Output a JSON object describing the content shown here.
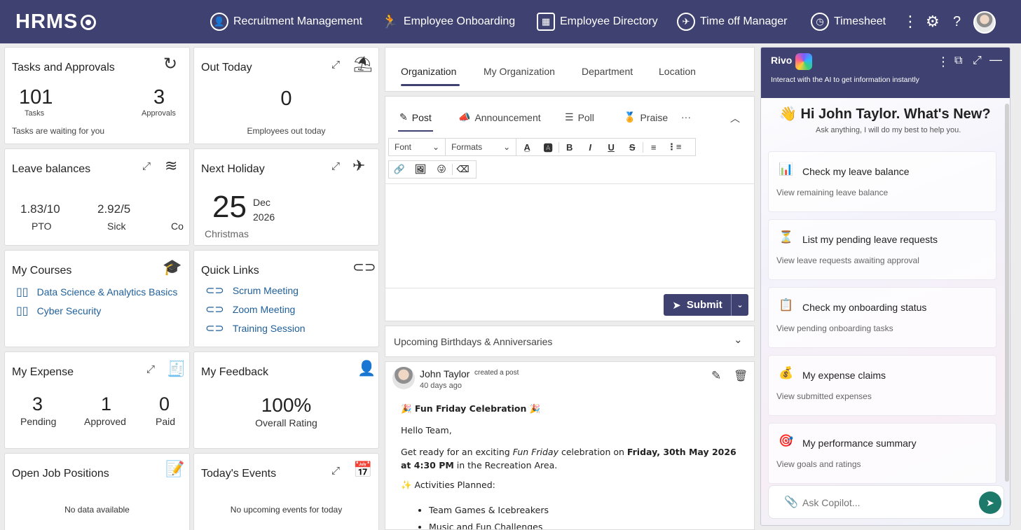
{
  "topbar": {
    "logo": "HRMS",
    "nav": [
      {
        "label": "Recruitment Management",
        "icon": "person-circle-icon"
      },
      {
        "label": "Employee Onboarding",
        "icon": "person-run-icon"
      },
      {
        "label": "Employee Directory",
        "icon": "directory-icon"
      },
      {
        "label": "Time off Manager",
        "icon": "calendar-plane-icon"
      },
      {
        "label": "Timesheet",
        "icon": "clock-icon"
      }
    ],
    "more_symbol": "⋮",
    "settings_symbol": "⚙",
    "help_symbol": "?"
  },
  "tasks": {
    "title": "Tasks and Approvals",
    "tasks_count": "101",
    "tasks_label": "Tasks",
    "approvals_count": "3",
    "approvals_label": "Approvals",
    "note": "Tasks are waiting for you"
  },
  "out_today": {
    "title": "Out Today",
    "count": "0",
    "label": "Employees out today"
  },
  "leave": {
    "title": "Leave balances",
    "items": [
      {
        "value": "1.83/10",
        "label": "PTO"
      },
      {
        "value": "2.92/5",
        "label": "Sick"
      },
      {
        "value": "",
        "label": "Co"
      }
    ]
  },
  "holiday": {
    "title": "Next Holiday",
    "day": "25",
    "month": "Dec",
    "year": "2026",
    "name": "Christmas"
  },
  "courses": {
    "title": "My Courses",
    "items": [
      "Data Science & Analytics Basics",
      "Cyber Security"
    ]
  },
  "quick_links": {
    "title": "Quick Links",
    "items": [
      "Scrum Meeting",
      "Zoom Meeting",
      "Training Session"
    ]
  },
  "expense": {
    "title": "My Expense",
    "items": [
      {
        "value": "3",
        "label": "Pending"
      },
      {
        "value": "1",
        "label": "Approved"
      },
      {
        "value": "0",
        "label": "Paid"
      }
    ]
  },
  "feedback": {
    "title": "My Feedback",
    "value": "100%",
    "label": "Overall Rating"
  },
  "jobs": {
    "title": "Open Job Positions",
    "empty": "No data available"
  },
  "events": {
    "title": "Today's Events",
    "empty": "No upcoming events for today"
  },
  "org_tabs": [
    "Organization",
    "My Organization",
    "Department",
    "Location"
  ],
  "composer": {
    "tabs": [
      "Post",
      "Announcement",
      "Poll",
      "Praise"
    ],
    "more": "···",
    "font": "Font",
    "formats": "Formats",
    "submit": "Submit"
  },
  "birthdays": {
    "title": "Upcoming Birthdays & Anniversaries"
  },
  "post": {
    "author": "John Taylor",
    "action": "created a post",
    "time": "40 days ago",
    "heading": "Fun Friday Celebration",
    "greeting": "Hello Team,",
    "line1_pre": "Get ready for an exciting ",
    "line1_em": "Fun Friday",
    "line1_mid": " celebration on ",
    "line1_bold": "Friday, 30th May 2026 at 4:30 PM",
    "line1_post": " in the Recreation Area.",
    "activities_label": "Activities Planned:",
    "activities": [
      "Team Games & Icebreakers",
      "Music and Fun Challenges"
    ]
  },
  "copilot": {
    "brand": "Rivo",
    "subtitle": "Interact with the AI to get information instantly",
    "greeting": "Hi John Taylor. What's New?",
    "prompt_hint": "Ask anything, I will do my best to help you.",
    "cards": [
      {
        "emoji": "📊",
        "title": "Check my leave balance",
        "sub": "View remaining leave balance"
      },
      {
        "emoji": "⏳",
        "title": "List my pending leave requests",
        "sub": "View leave requests awaiting approval"
      },
      {
        "emoji": "📋",
        "title": "Check my onboarding status",
        "sub": "View pending onboarding tasks"
      },
      {
        "emoji": "💰",
        "title": "My expense claims",
        "sub": "View submitted expenses"
      },
      {
        "emoji": "🎯",
        "title": "My performance summary",
        "sub": "View goals and ratings"
      }
    ],
    "input_placeholder": "Ask Copilot..."
  },
  "colors": {
    "brand": "#3f4170",
    "link": "#1f5f99",
    "send": "#1d7a6a"
  }
}
